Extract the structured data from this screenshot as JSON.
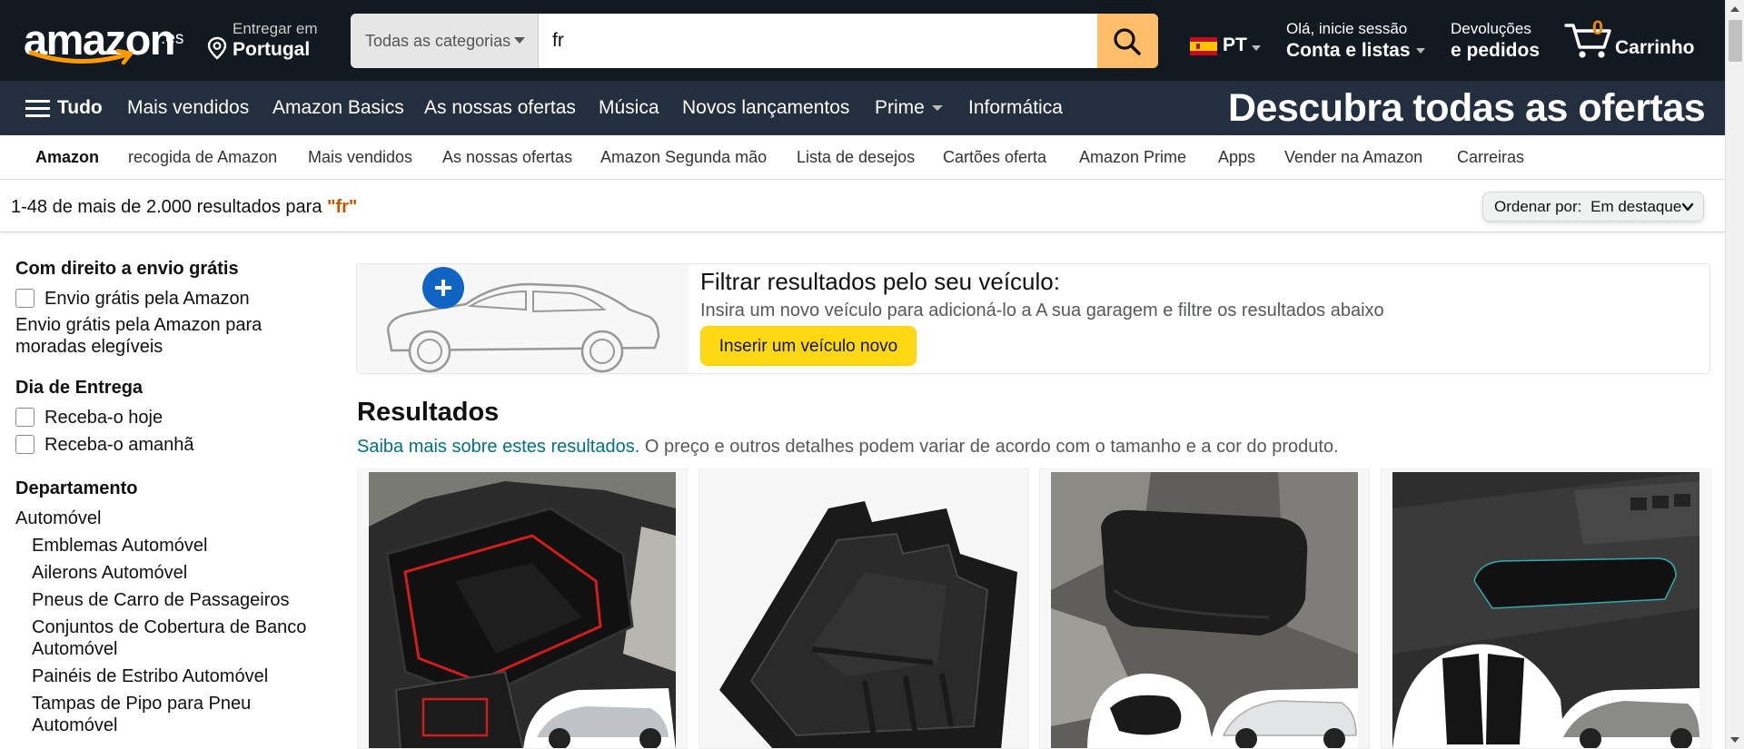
{
  "header": {
    "logo_text": "amazon",
    "logo_tld": ".es",
    "deliver_line1": "Entregar em",
    "deliver_line2": "Portugal",
    "search_category": "Todas as categorias",
    "search_value": "fr",
    "language": "PT",
    "account_line1": "Olá, inicie sessão",
    "account_line2": "Conta e listas",
    "orders_line1": "Devoluções",
    "orders_line2": "e pedidos",
    "cart_count": "0",
    "cart_label": "Carrinho",
    "bg_color": "#131921",
    "search_button_color": "#febd69"
  },
  "subnav": {
    "all_label": "Tudo",
    "items": [
      "Mais vendidos",
      "Amazon Basics",
      "As nossas ofertas",
      "Música",
      "Novos lançamentos",
      "Prime",
      "Informática"
    ],
    "promo": "Descubra todas as ofertas",
    "bg_color": "#232f3e"
  },
  "secnav": {
    "items": [
      "Amazon",
      "recogida de Amazon",
      "Mais vendidos",
      "As nossas ofertas",
      "Amazon Segunda mão",
      "Lista de desejos",
      "Cartões oferta",
      "Amazon Prime",
      "Apps",
      "Vender na Amazon",
      "Carreiras"
    ]
  },
  "results_bar": {
    "count_text": "1-48 de mais de 2.000 resultados para ",
    "query": "\"fr\"",
    "sort_label": "Ordenar por:",
    "sort_value": "Em destaque"
  },
  "filters": {
    "shipping_heading": "Com direito a envio grátis",
    "shipping_option": "Envio grátis pela Amazon",
    "shipping_note": "Envio grátis pela Amazon para moradas elegíveis",
    "delivery_heading": "Dia de Entrega",
    "delivery_options": [
      "Receba-o hoje",
      "Receba-o amanhã"
    ],
    "department_heading": "Departamento",
    "department": "Automóvel",
    "subdepartments": [
      "Emblemas Automóvel",
      "Ailerons Automóvel",
      "Pneus de Carro de Passageiros",
      "Conjuntos de Cobertura de Banco Automóvel",
      "Painéis de Estribo Automóvel",
      "Tampas de Pipo para Pneu Automóvel"
    ]
  },
  "vehicle": {
    "title": "Filtrar resultados pelo seu veículo:",
    "subtitle": "Insira um novo veículo para adicioná-lo a A sua garagem e filtre os resultados abaixo",
    "button": "Inserir um veículo novo"
  },
  "results": {
    "heading": "Resultados",
    "link": "Saiba mais sobre estes resultados.",
    "note": " O preço e outros detalhes podem variar de acordo com o tamanho e a cor do produto."
  },
  "products": [
    {
      "icon": "armrest-storage-tray-image"
    },
    {
      "icon": "console-organizer-tray-image"
    },
    {
      "icon": "armrest-cover-image"
    },
    {
      "icon": "door-storage-box-image"
    }
  ]
}
